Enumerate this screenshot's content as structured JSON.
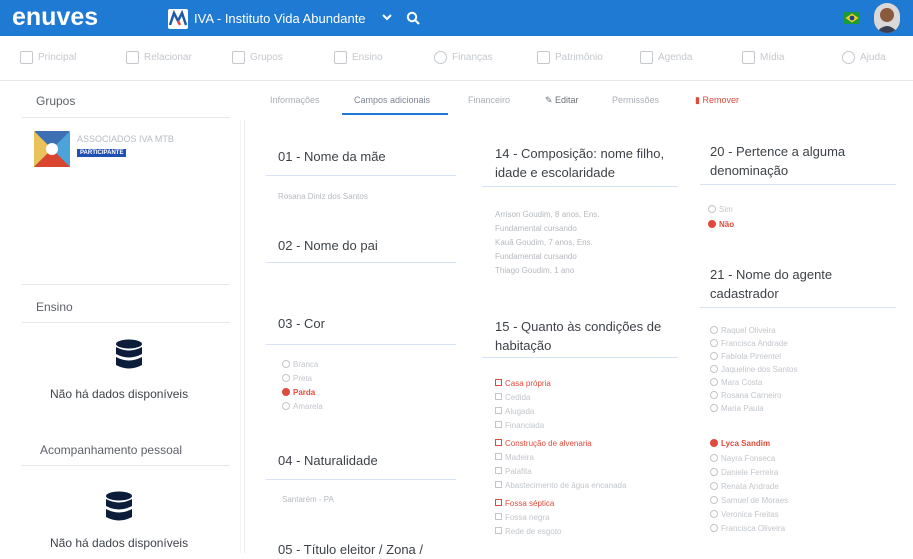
{
  "header": {
    "logo": "enuves",
    "org_logo_text": "IVA",
    "org_name": "IVA - Instituto Vida Abundante",
    "colors": {
      "primary": "#1f7ad3",
      "danger": "#e04a3c"
    }
  },
  "nav": {
    "items": [
      {
        "label": "Principal",
        "icon": "home-icon"
      },
      {
        "label": "Relacionar",
        "icon": "users-icon"
      },
      {
        "label": "Grupos",
        "icon": "grid-icon"
      },
      {
        "label": "Ensino",
        "icon": "graduation-icon"
      },
      {
        "label": "Finanças",
        "icon": "coin-icon"
      },
      {
        "label": "Patrimônio",
        "icon": "building-icon"
      },
      {
        "label": "Agenda",
        "icon": "calendar-icon"
      },
      {
        "label": "Mídia",
        "icon": "media-icon"
      },
      {
        "label": "Ajuda",
        "icon": "help-icon"
      }
    ]
  },
  "sidebar": {
    "groups_title": "Grupos",
    "group_name": "ASSOCIADOS IVA MTB",
    "group_badge": "PARTICIPANTE",
    "teaching_title": "Ensino",
    "teaching_empty": "Não há dados disponíveis",
    "followup_title": "Acompanhamento pessoal",
    "followup_empty": "Não há dados disponíveis"
  },
  "tabs": {
    "info": "Informações",
    "extra": "Campos adicionais",
    "financial": "Financeiro",
    "edit": "Editar",
    "permissions": "Permissões",
    "remove": "Remover"
  },
  "fields": {
    "mother_title": "01 - Nome da mãe",
    "mother_value": "Rosana Diniz dos Santos",
    "father_title": "02 - Nome do pai",
    "color_title": "03 - Cor",
    "color_options": [
      "Branca",
      "Preta",
      "Parda",
      "Amarela"
    ],
    "color_selected": "Parda",
    "birthplace_title": "04 - Naturalidade",
    "birthplace_value": "Santarém - PA",
    "voter_title": "05 - Título eleitor / Zona /",
    "family_title": "14 - Composição: nome filho, idade e escolaridade",
    "family_lines": [
      "Arrison Goudim, 8 anos, Ens.",
      "Fundamental cursando",
      "Kauã Goudim, 7 anos, Ens.",
      "Fundamental cursando",
      "Thiago Goudim, 1 ano"
    ],
    "housing_title": "15 - Quanto às condições de habitação",
    "housing_options": [
      "Casa própria",
      "Cedida",
      "Alugada",
      "Financiada",
      "Construção de alvenaria",
      "Madeira",
      "Palafita",
      "Abastecimento de água encanada",
      "Fossa séptica",
      "Fossa negra",
      "Rede de esgoto"
    ],
    "housing_checked": [
      "Casa própria",
      "Construção de alvenaria",
      "Fossa séptica"
    ],
    "denomination_title": "20 - Pertence a alguma denominação",
    "denomination_options": [
      "Sim",
      "Não"
    ],
    "denomination_selected": "Não",
    "agent_title": "21 - Nome do agente cadastrador",
    "agent_options": [
      "Raquel Oliveira",
      "Francisca Andrade",
      "Fabíola Pimentel",
      "Jaqueline dos Santos",
      "Mara Costa",
      "Rosana Carneiro",
      "Maria Paula",
      "Lyca Sandim",
      "Nayra Fonseca",
      "Daniele Ferreira",
      "Renata Andrade",
      "Samuel de Moraes",
      "Veronica Freitas",
      "Francisca Oliveira"
    ],
    "agent_selected": "Lyca Sandim"
  }
}
